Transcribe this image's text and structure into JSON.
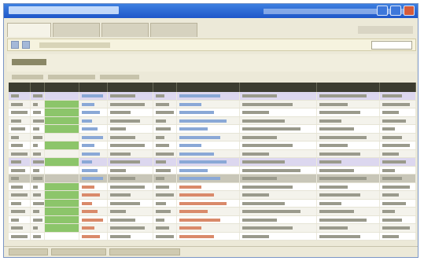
{
  "window": {
    "colors": {
      "titlebar": "#1f57c9",
      "header": "#3c3c30",
      "highlight": "#8cc56a",
      "selection": "#dcd7ef"
    }
  },
  "icons": [
    "minimize-icon",
    "maximize-icon",
    "close-icon",
    "search-icon"
  ],
  "grid": {
    "column_count": 10,
    "row_count": 18,
    "rows": [
      {
        "style": "selected",
        "green": false
      },
      {
        "style": "alt",
        "green": true
      },
      {
        "style": "",
        "green": true
      },
      {
        "style": "alt",
        "green": true
      },
      {
        "style": "",
        "green": true
      },
      {
        "style": "alt",
        "green": false
      },
      {
        "style": "",
        "green": true
      },
      {
        "style": "alt",
        "green": false
      },
      {
        "style": "selected",
        "green": true
      },
      {
        "style": "",
        "green": false
      },
      {
        "style": "dark",
        "green": false
      },
      {
        "style": "",
        "green": true
      },
      {
        "style": "alt",
        "green": true
      },
      {
        "style": "",
        "green": true
      },
      {
        "style": "alt",
        "green": true
      },
      {
        "style": "",
        "green": true
      },
      {
        "style": "alt",
        "green": true
      },
      {
        "style": "",
        "green": false
      }
    ]
  }
}
